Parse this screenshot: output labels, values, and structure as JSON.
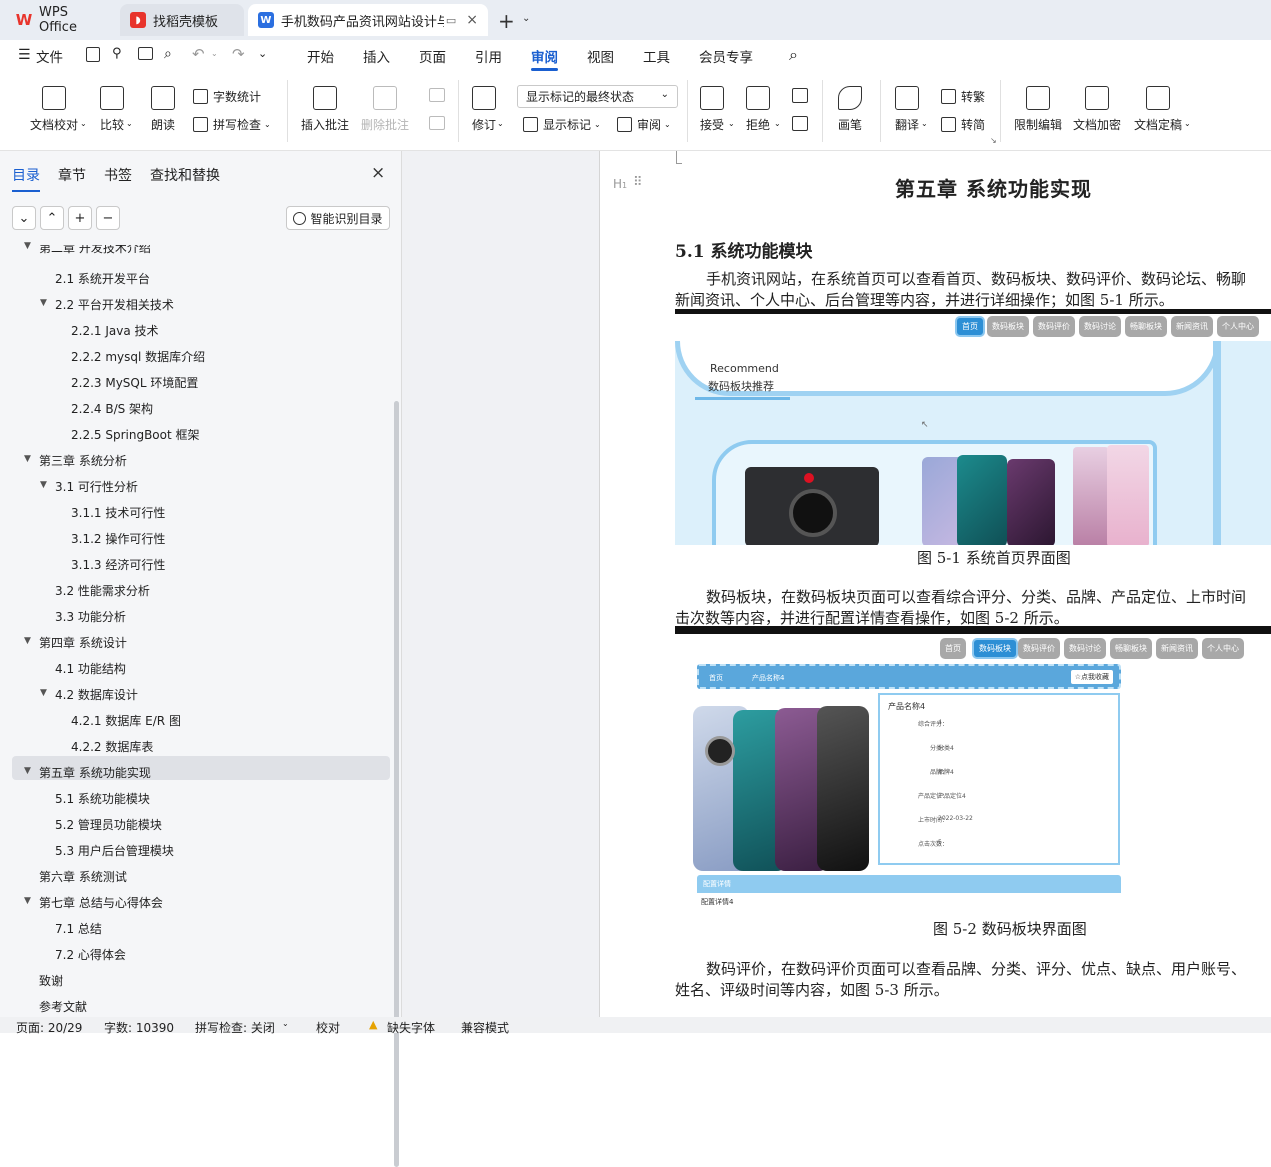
{
  "tabs": [
    {
      "label": "WPS Office"
    },
    {
      "label": "找稻壳模板"
    },
    {
      "label": "手机数码产品资讯网站设计与"
    }
  ],
  "menu": [
    "文件",
    "开始",
    "插入",
    "页面",
    "引用",
    "审阅",
    "视图",
    "工具",
    "会员专享"
  ],
  "ribbon": {
    "doc_check": "文档校对",
    "compare": "比较",
    "read_aloud": "朗读",
    "word_count": "字数统计",
    "spell_check": "拼写检查",
    "insert_comment": "插入批注",
    "delete_comment": "删除批注",
    "revise": "修订",
    "markup_select": "显示标记的最终状态",
    "show_markup": "显示标记",
    "review": "审阅",
    "accept": "接受",
    "reject": "拒绝",
    "pen": "画笔",
    "translate": "翻译",
    "to_trad": "转繁",
    "to_simp": "转简",
    "restrict_edit": "限制编辑",
    "encrypt": "文档加密",
    "finalize": "文档定稿"
  },
  "sidebar": {
    "tabs": [
      "目录",
      "章节",
      "书签",
      "查找和替换"
    ],
    "smart_btn": "智能识别目录",
    "toc": [
      {
        "label": "第二章 开发技术介绍",
        "level": 1,
        "partial": true
      },
      {
        "label": "2.1  系统开发平台",
        "level": 2
      },
      {
        "label": "2.2  平台开发相关技术",
        "level": 2,
        "expanded": true
      },
      {
        "label": "2.2.1 Java 技术",
        "level": 3
      },
      {
        "label": "2.2.2 mysql 数据库介绍",
        "level": 3
      },
      {
        "label": "2.2.3 MySQL 环境配置",
        "level": 3
      },
      {
        "label": "2.2.4 B/S 架构",
        "level": 3
      },
      {
        "label": "2.2.5 SpringBoot 框架",
        "level": 3
      },
      {
        "label": "第三章  系统分析",
        "level": 1,
        "expanded": true
      },
      {
        "label": "3.1  可行性分析",
        "level": 2,
        "expanded": true
      },
      {
        "label": "3.1.1 技术可行性",
        "level": 3
      },
      {
        "label": "3.1.2 操作可行性",
        "level": 3
      },
      {
        "label": "3.1.3   经济可行性",
        "level": 3
      },
      {
        "label": "3.2 性能需求分析",
        "level": 2
      },
      {
        "label": "3.3 功能分析",
        "level": 2
      },
      {
        "label": "第四章  系统设计",
        "level": 1,
        "expanded": true
      },
      {
        "label": "4.1 功能结构",
        "level": 2
      },
      {
        "label": "4.2  数据库设计",
        "level": 2,
        "expanded": true
      },
      {
        "label": "4.2.1   数据库 E/R 图",
        "level": 3
      },
      {
        "label": "4.2.2   数据库表",
        "level": 3
      },
      {
        "label": "第五章  系统功能实现",
        "level": 1,
        "expanded": true,
        "selected": true
      },
      {
        "label": "5.1 系统功能模块",
        "level": 2
      },
      {
        "label": "5.2  管理员功能模块",
        "level": 2
      },
      {
        "label": "5.3  用户后台管理模块",
        "level": 2
      },
      {
        "label": "第六章  系统测试",
        "level": 1
      },
      {
        "label": "第七章  总结与心得体会",
        "level": 1,
        "expanded": true
      },
      {
        "label": "7.1   总结",
        "level": 2
      },
      {
        "label": "7.2   心得体会",
        "level": 2
      },
      {
        "label": "致谢",
        "level": 1
      },
      {
        "label": "参考文献",
        "level": 1
      }
    ]
  },
  "doc": {
    "chapter_title": "第五章  系统功能实现",
    "section_title": "5.1 系统功能模块",
    "para1_line1": "手机资讯网站，在系统首页可以查看首页、数码板块、数码评价、数码论坛、畅聊",
    "para1_line2": "新闻资讯、个人中心、后台管理等内容，并进行详细操作；如图 5-1 所示。",
    "fig1_nav": [
      "首页",
      "数码板块",
      "数码评价",
      "数码讨论",
      "畅聊板块",
      "新闻资讯",
      "个人中心"
    ],
    "fig1_recommend_en": "Recommend",
    "fig1_recommend_cn": "数码板块推荐",
    "fig1_caption": "图 5-1 系统首页界面图",
    "para2_line1": "数码板块，在数码板块页面可以查看综合评分、分类、品牌、产品定位、上市时间",
    "para2_line2": "击次数等内容，并进行配置详情查看操作，如图 5-2 所示。",
    "fig2_nav": [
      "首页",
      "数码板块",
      "数码评价",
      "数码讨论",
      "畅聊板块",
      "新闻资讯",
      "个人中心"
    ],
    "fig2_bar_home": "首页",
    "fig2_bar_name": "产品名称4",
    "fig2_fav": "☆点我收藏",
    "fig2_title": "产品名称4",
    "fig2_fields": [
      {
        "k": "综合评分：",
        "v": "4"
      },
      {
        "k": "分类：",
        "v": "分类4"
      },
      {
        "k": "品牌：",
        "v": "品牌4"
      },
      {
        "k": "产品定位：",
        "v": "产品定位4"
      },
      {
        "k": "上市时间：",
        "v": "2022-03-22"
      },
      {
        "k": "点击次数：",
        "v": "5"
      }
    ],
    "fig2_config_tab": "配置详情",
    "fig2_config_text": "配置详情4",
    "fig2_caption": "图 5-2 数码板块界面图",
    "para3_line1": "数码评价，在数码评价页面可以查看品牌、分类、评分、优点、缺点、用户账号、",
    "para3_line2": "姓名、评级时间等内容，如图 5-3 所示。"
  },
  "status": {
    "page": "页面: 20/29",
    "words": "字数: 10390",
    "spell": "拼写检查: 关闭",
    "proof": "校对",
    "missing_font": "缺失字体",
    "compat": "兼容模式"
  },
  "colors": {
    "accent": "#1a5fd0",
    "wps_red": "#e8342c",
    "nav_blue": "#2d8fd5"
  }
}
